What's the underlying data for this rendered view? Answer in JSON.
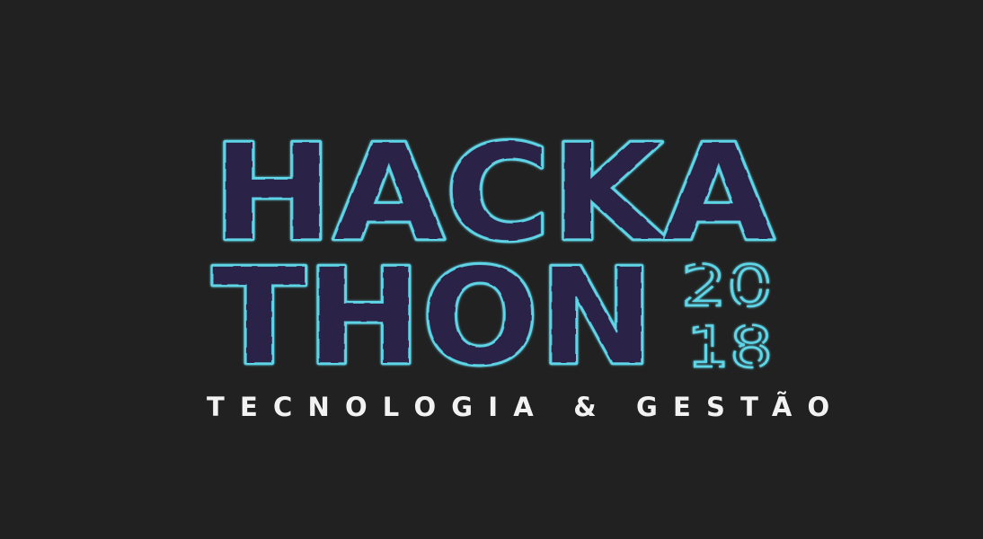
{
  "logo": {
    "line1": "HACKA",
    "line2": "THON",
    "year_top": "20",
    "year_bottom": "18",
    "tagline": "TECNOLOGIA & GESTÃO"
  },
  "colors": {
    "background": "#212121",
    "letter_fill": "#2a2346",
    "outline": "#5fd6e8",
    "tagline": "#f2f2f2"
  }
}
